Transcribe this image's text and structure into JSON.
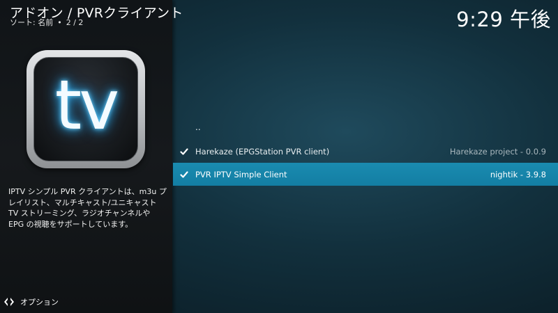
{
  "header": {
    "title": "アドオン / PVRクライアント",
    "sort_label": "ソート: 名前",
    "bullet": "•",
    "page_info": "2 / 2"
  },
  "clock": "9:29 午後",
  "addon": {
    "icon_text": "tv",
    "icon_name": "tv-addon-icon",
    "description": "IPTV シンプル PVR クライアントは、m3u プレイリスト、マルチキャスト/ユニキャスト TV ストリーミング、ラジオチャンネルや EPG の視聴をサポートしています。"
  },
  "list": {
    "parent_label": "..",
    "items": [
      {
        "name": "Harekaze (EPGStation PVR client)",
        "meta": "Harekaze project - 0.0.9",
        "installed": true,
        "selected": false
      },
      {
        "name": "PVR IPTV Simple Client",
        "meta": "nightik - 3.9.8",
        "installed": true,
        "selected": true
      }
    ]
  },
  "footer": {
    "options_label": "オプション",
    "options_icon": "options-arrows-icon"
  },
  "colors": {
    "selection": "#1682a8",
    "background": "#12303d",
    "side_panel": "#14171a",
    "tv_glow": "#2fa9e8"
  }
}
